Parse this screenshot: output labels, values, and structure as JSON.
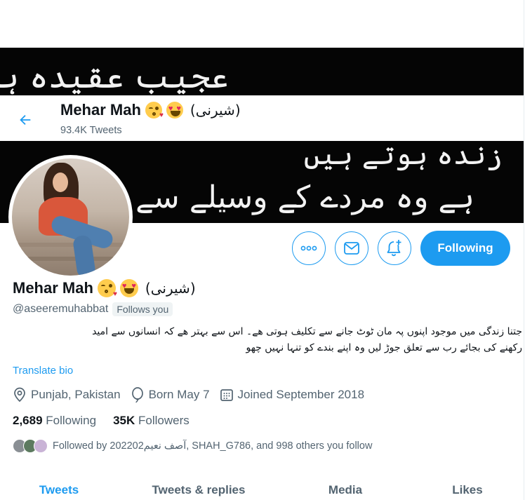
{
  "banner": {
    "line1": "عجیب عقیدہ ہے !",
    "line2": "ہے وہ مردے کے وسیلے سے",
    "line3": "زندہ ہوتے ہیں"
  },
  "header": {
    "name": "Mehar Mah",
    "urdu_name": "(شیرنی)",
    "tweet_count": "93.4K Tweets"
  },
  "actions": {
    "follow_label": "Following"
  },
  "profile": {
    "name": "Mehar Mah",
    "urdu_name": "(شیرنی)",
    "handle": "@aseeremuhabbat",
    "follows_you": "Follows you",
    "bio_line1": "جتنا زندگی میں موجود اپنوں پہ مان ٹوٹ جانے سے تکلیف ہوتی ھے۔ اس سے بہتر ھے کہ انسانوں سے امید",
    "bio_line2": "رکھنے کی بجائے رب سے تعلق جوڑ لیں وہ اپنے بندے کو تنہا نہیں چھو",
    "translate": "Translate bio",
    "location": "Punjab, Pakistan",
    "birthday": "Born May 7",
    "joined": "Joined September 2018",
    "following_count": "2,689",
    "following_label": "Following",
    "followers_count": "35K",
    "followers_label": "Followers",
    "followed_by": "Followed by 202202آصف نعیم, SHAH_G786, and 998 others you follow"
  },
  "tabs": [
    {
      "label": "Tweets",
      "active": true
    },
    {
      "label": "Tweets & replies",
      "active": false
    },
    {
      "label": "Media",
      "active": false
    },
    {
      "label": "Likes",
      "active": false
    }
  ],
  "colors": {
    "accent": "#1d9bf0",
    "secondary_text": "#536471",
    "banner_bg": "#050505"
  }
}
